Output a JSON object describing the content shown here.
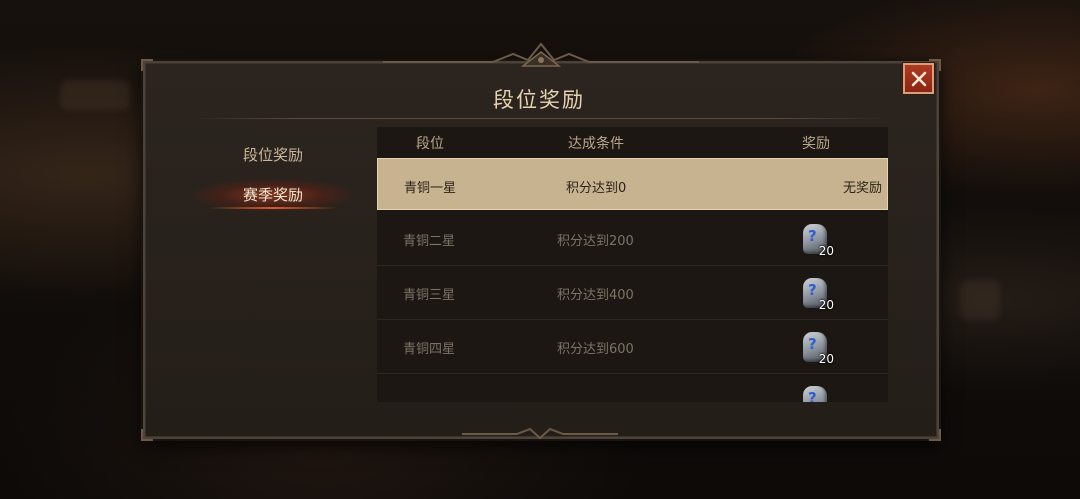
{
  "dialog": {
    "title": "段位奖励",
    "close_icon": "close-x-icon"
  },
  "tabs": [
    {
      "label": "段位奖励",
      "active": false
    },
    {
      "label": "赛季奖励",
      "active": true
    }
  ],
  "table": {
    "headers": {
      "rank": "段位",
      "condition": "达成条件",
      "reward": "奖励"
    },
    "rows": [
      {
        "rank": "青铜一星",
        "condition": "积分达到0",
        "reward_text": "无奖励",
        "selected": true
      },
      {
        "rank": "青铜二星",
        "condition": "积分达到200",
        "reward_icon": "mystery-stone-icon",
        "reward_count": "20"
      },
      {
        "rank": "青铜三星",
        "condition": "积分达到400",
        "reward_icon": "mystery-stone-icon",
        "reward_count": "20"
      },
      {
        "rank": "青铜四星",
        "condition": "积分达到600",
        "reward_icon": "mystery-stone-icon",
        "reward_count": "20"
      }
    ]
  },
  "colors": {
    "accent": "#e0592b",
    "selected_row": "#c8b391",
    "title": "#e6d2b0"
  }
}
